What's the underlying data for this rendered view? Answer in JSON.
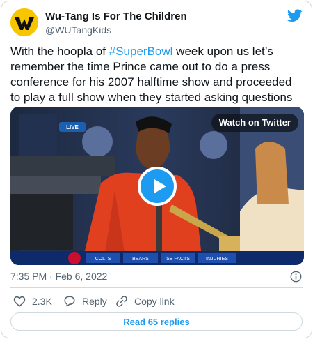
{
  "tweet": {
    "display_name": "Wu-Tang Is For The Children",
    "handle": "@WUTangKids",
    "text_before": "With the hoopla of ",
    "hashtag": "#SuperBowl",
    "text_after": " week upon us let’s remember the time Prince came out to do a press conference for his 2007 halftime show and proceeded to play a full show when they started asking questions",
    "timestamp": "7:35 PM · Feb 6, 2022"
  },
  "media": {
    "watch_label": "Watch on Twitter",
    "live_label": "LIVE",
    "ticker": [
      "COLTS",
      "BEARS",
      "SB FACTS",
      "INJURIES"
    ]
  },
  "actions": {
    "like_count": "2.3K",
    "reply_label": "Reply",
    "copy_label": "Copy link"
  },
  "footer": {
    "read_replies": "Read 65 replies"
  },
  "colors": {
    "accent": "#1d9bf0",
    "text": "#0f1419",
    "muted": "#536471",
    "border": "#cfd9de",
    "avatar_bg": "#f7c600"
  },
  "icons": [
    "wu-tang-logo-icon",
    "twitter-bird-icon",
    "play-icon",
    "info-icon",
    "heart-icon",
    "reply-icon",
    "link-icon"
  ]
}
